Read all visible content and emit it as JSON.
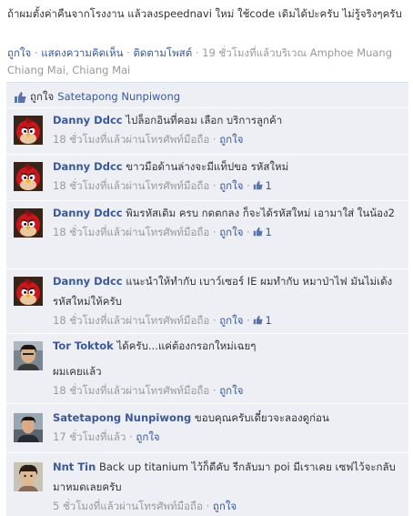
{
  "post": {
    "text": "ถ้าผมตั้งค่าคืนจากโรงงาน แล้วลงspeednavi ใหม่ ใช้code เดิมได้ปะครับ ไม่รู้จริงๆครับ",
    "actions": {
      "like": "ถูกใจ",
      "comment": "แสดงความคิดเห็น",
      "follow": "ติดตามโพสต์",
      "dot": "·",
      "time_location": "19 ชั่วโมงที่แล้วบริเวณ Amphoe Muang Chiang Mai, Chiang Mai"
    }
  },
  "likes": {
    "label": "ถูกใจ",
    "name": "Satetapong Nunpiwong"
  },
  "comments": [
    {
      "avatar": "angry-bird-avatar",
      "name": "Danny Ddcc",
      "text": "ไปล็อกอินที่คอม เลือก บริการลูกค้า",
      "time": "18 ชั่วโมงที่แล้วผ่านโทรศัพท์มือถือ",
      "like_label": "ถูกใจ",
      "likes": ""
    },
    {
      "avatar": "angry-bird-avatar",
      "name": "Danny Ddcc",
      "text": "ขาวมือด้านล่างจะมีแท็ปขอ รหัสใหม่",
      "time": "18 ชั่วโมงที่แล้วผ่านโทรศัพท์มือถือ",
      "like_label": "ถูกใจ",
      "likes": "1"
    },
    {
      "avatar": "angry-bird-avatar",
      "name": "Danny Ddcc",
      "text": "พิมรหัสเดิม ครบ กดตกลง ก็จะได้รหัสใหม่ เอามาใส่ ในน้อง2",
      "time": "18 ชั่วโมงที่แล้วผ่านโทรศัพท์มือถือ",
      "like_label": "ถูกใจ",
      "likes": "1"
    },
    {
      "avatar": "angry-bird-avatar",
      "name": "Danny Ddcc",
      "text": "แนะนำให้ทำกับ เบาว์เซอร์ IE ผมทำกับ หมาป่าไฟ มันไม่เด้งรหัสใหม่ให้ครับ",
      "time": "18 ชั่วโมงที่แล้วผ่านโทรศัพท์มือถือ",
      "like_label": "ถูกใจ",
      "likes": "1"
    },
    {
      "avatar": "tor-avatar",
      "name": "Tor Toktok",
      "text": "ได้ครับ...แค่ต้องกรอกใหม่เฉยๆ",
      "text2": "ผมเคยแล้ว",
      "time": "18 ชั่วโมงที่แล้วผ่านโทรศัพท์มือถือ",
      "like_label": "ถูกใจ",
      "likes": ""
    },
    {
      "avatar": "satetapong-avatar",
      "name": "Satetapong Nunpiwong",
      "text": "ขอบคุณครับเดี๋ยวจะลองดูก่อน",
      "time": "17 ชั่วโมงที่แล้ว",
      "like_label": "ถูกใจ",
      "likes": ""
    },
    {
      "avatar": "nnt-avatar",
      "name": "Nnt Tin",
      "text": "Back up titanium ไว้ก็ดีคับ รีกลับมา poi มีเราเคย เซฟไว้จะกลับมาหมดเลยครับ",
      "time": "5 ชั่วโมงที่แล้วผ่านโทรศัพท์มือถือ",
      "like_label": "ถูกใจ",
      "likes": ""
    }
  ],
  "colors": {
    "link": "#3b5998",
    "panel": "#edeff4",
    "meta": "#999999"
  }
}
